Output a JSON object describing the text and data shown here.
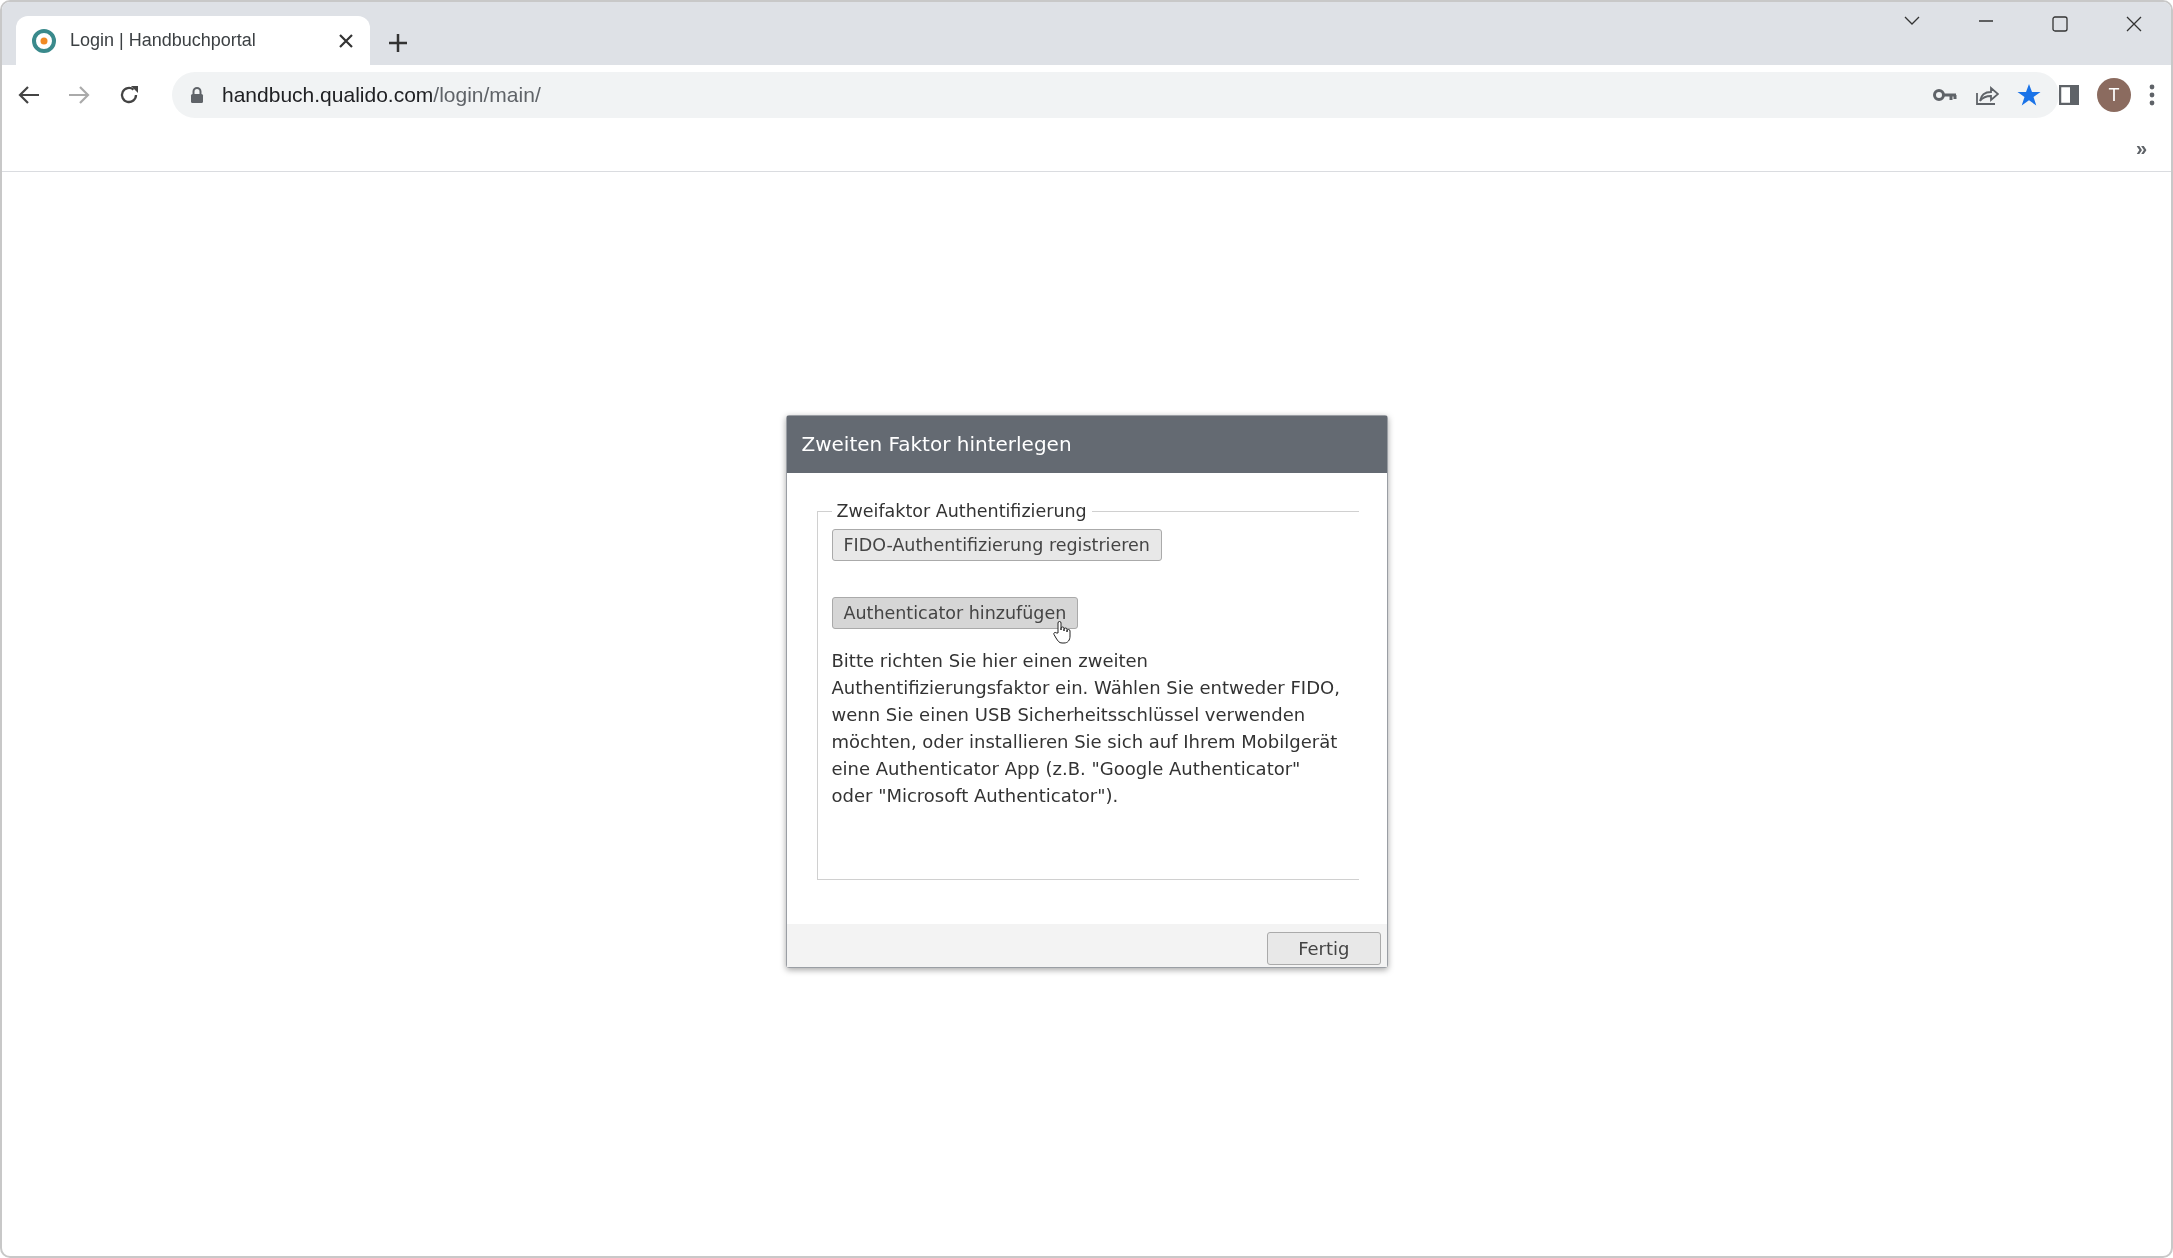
{
  "browser": {
    "tab": {
      "title": "Login | Handbuchportal",
      "selected": true
    },
    "url": {
      "host": "handbuch.qualido.com",
      "path": "/login/main/"
    },
    "profile_initial": "T",
    "bookmark_overflow": "»"
  },
  "dialog": {
    "title": "Zweiten Faktor hinterlegen",
    "group_label": "Zweifaktor Authentifizierung",
    "buttons": [
      {
        "label": "FIDO-Authentifizierung registrieren",
        "hovered": false
      },
      {
        "label": "Authenticator hinzufügen",
        "hovered": true
      }
    ],
    "description": "Bitte richten Sie hier einen zweiten Authentifizierungsfaktor ein. Wählen Sie entweder FIDO, wenn Sie einen USB Sicherheitsschlüssel verwenden möchten, oder installieren Sie sich auf Ihrem Mobilgerät eine Authenticator App (z.B. \"Google Authenticator\" oder \"Microsoft Authenticator\").",
    "footer_button": "Fertig"
  }
}
